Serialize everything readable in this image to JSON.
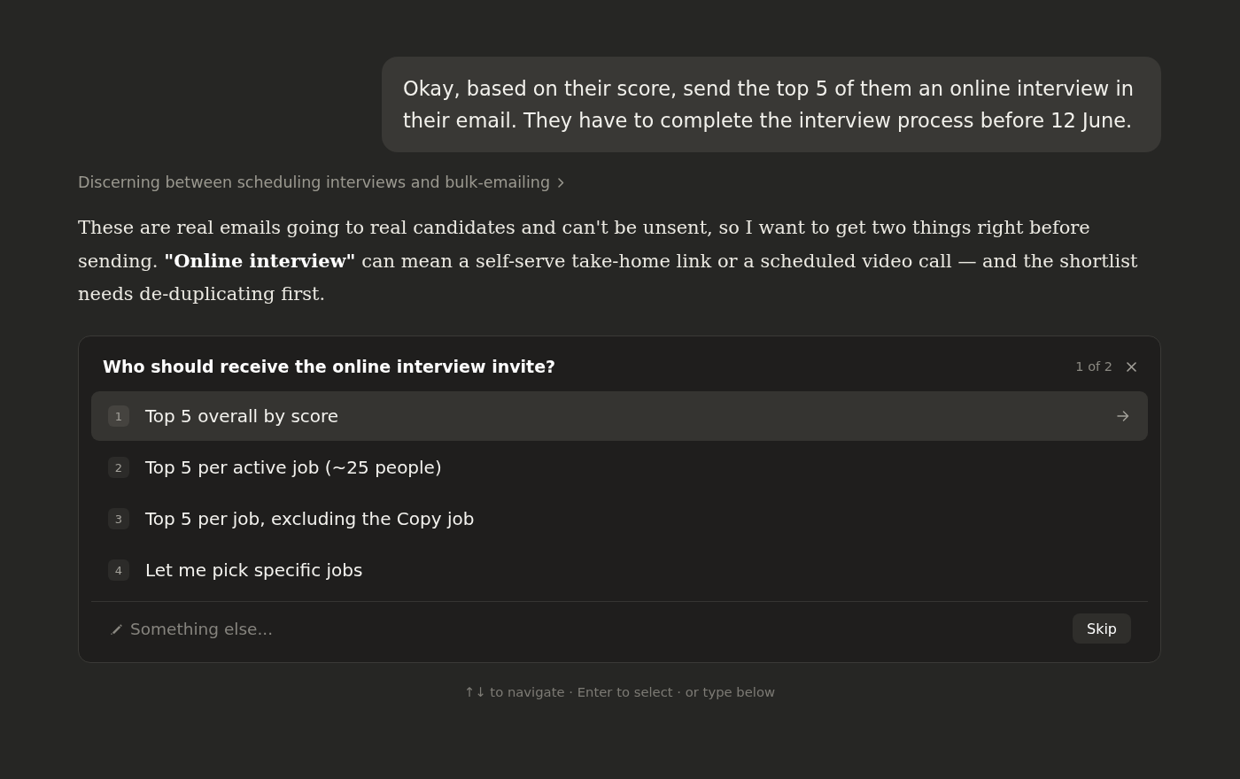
{
  "user_message": {
    "text": "Okay, based on their score, send the top 5 of them an online interview in their email. They have to complete the interview process before 12 June."
  },
  "thinking": {
    "label": "Discerning between scheduling interviews and bulk-emailing",
    "expanded": false
  },
  "response": {
    "text": "These are real emails going to real candidates and can't be unsent, so I want to get two things right before sending. **\"Online interview\"** can mean a self-serve take-home link or a scheduled video call — and the shortlist needs de-duplicating first."
  },
  "question_card": {
    "title": "Who should receive the online interview invite?",
    "counter": "1 of 2",
    "options": [
      {
        "number": "1",
        "label": "Top 5 overall by score",
        "selected": true
      },
      {
        "number": "2",
        "label": "Top 5 per active job (~25 people)",
        "selected": false
      },
      {
        "number": "3",
        "label": "Top 5 per job, excluding the Copy job",
        "selected": false
      },
      {
        "number": "4",
        "label": "Let me pick specific jobs",
        "selected": false
      }
    ],
    "input": {
      "placeholder": "Something else..."
    },
    "skip_button": "Skip"
  },
  "hint": "↑↓ to navigate · Enter to select · or type below"
}
